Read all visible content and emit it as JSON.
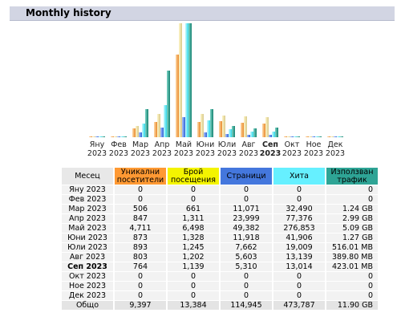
{
  "section_title": "Monthly history",
  "colors": {
    "visitors": "#ff9933",
    "visits": "#f4f400",
    "pages": "#4477dd",
    "hits": "#66f0ff",
    "bandwidth": "#2ea495"
  },
  "chart_data": {
    "type": "bar",
    "categories": [
      {
        "month": "Яну",
        "year": "2023",
        "bold": false
      },
      {
        "month": "Фев",
        "year": "2023",
        "bold": false
      },
      {
        "month": "Мар",
        "year": "2023",
        "bold": false
      },
      {
        "month": "Апр",
        "year": "2023",
        "bold": false
      },
      {
        "month": "Май",
        "year": "2023",
        "bold": false
      },
      {
        "month": "Юни",
        "year": "2023",
        "bold": false
      },
      {
        "month": "Юли",
        "year": "2023",
        "bold": false
      },
      {
        "month": "Авг",
        "year": "2023",
        "bold": false
      },
      {
        "month": "Сеп",
        "year": "2023",
        "bold": true
      },
      {
        "month": "Окт",
        "year": "2023",
        "bold": false
      },
      {
        "month": "Ное",
        "year": "2023",
        "bold": false
      },
      {
        "month": "Дек",
        "year": "2023",
        "bold": false
      }
    ],
    "series": [
      {
        "key": "visitors",
        "values": [
          0,
          0,
          506,
          847,
          4711,
          873,
          893,
          803,
          764,
          0,
          0,
          0
        ]
      },
      {
        "key": "visits",
        "values": [
          0,
          0,
          661,
          1311,
          6498,
          1328,
          1245,
          1202,
          1139,
          0,
          0,
          0
        ]
      },
      {
        "key": "pages",
        "values": [
          0,
          0,
          11071,
          23999,
          49382,
          11918,
          7662,
          5603,
          5310,
          0,
          0,
          0
        ]
      },
      {
        "key": "hits",
        "values": [
          0,
          0,
          32490,
          77376,
          276853,
          41906,
          19009,
          13139,
          13014,
          0,
          0,
          0
        ]
      },
      {
        "key": "bandwidth",
        "values": [
          0,
          0,
          1.24,
          2.99,
          5.09,
          1.27,
          0.504,
          0.381,
          0.413,
          0,
          0,
          0
        ]
      }
    ]
  },
  "table": {
    "headers": {
      "month": "Месец",
      "visitors": "Уникални посетители",
      "visits": "Брой посещения",
      "pages": "Страници",
      "hits": "Хита",
      "bandwidth": "Използван трафик"
    },
    "rows": [
      {
        "month": "Яну 2023",
        "visitors": "0",
        "visits": "0",
        "pages": "0",
        "hits": "0",
        "bandwidth": "0",
        "current": false
      },
      {
        "month": "Фев 2023",
        "visitors": "0",
        "visits": "0",
        "pages": "0",
        "hits": "0",
        "bandwidth": "0",
        "current": false
      },
      {
        "month": "Мар 2023",
        "visitors": "506",
        "visits": "661",
        "pages": "11,071",
        "hits": "32,490",
        "bandwidth": "1.24 GB",
        "current": false
      },
      {
        "month": "Апр 2023",
        "visitors": "847",
        "visits": "1,311",
        "pages": "23,999",
        "hits": "77,376",
        "bandwidth": "2.99 GB",
        "current": false
      },
      {
        "month": "Май 2023",
        "visitors": "4,711",
        "visits": "6,498",
        "pages": "49,382",
        "hits": "276,853",
        "bandwidth": "5.09 GB",
        "current": false
      },
      {
        "month": "Юни 2023",
        "visitors": "873",
        "visits": "1,328",
        "pages": "11,918",
        "hits": "41,906",
        "bandwidth": "1.27 GB",
        "current": false
      },
      {
        "month": "Юли 2023",
        "visitors": "893",
        "visits": "1,245",
        "pages": "7,662",
        "hits": "19,009",
        "bandwidth": "516.01 MB",
        "current": false
      },
      {
        "month": "Авг 2023",
        "visitors": "803",
        "visits": "1,202",
        "pages": "5,603",
        "hits": "13,139",
        "bandwidth": "389.80 MB",
        "current": false
      },
      {
        "month": "Сеп 2023",
        "visitors": "764",
        "visits": "1,139",
        "pages": "5,310",
        "hits": "13,014",
        "bandwidth": "423.01 MB",
        "current": true
      },
      {
        "month": "Окт 2023",
        "visitors": "0",
        "visits": "0",
        "pages": "0",
        "hits": "0",
        "bandwidth": "0",
        "current": false
      },
      {
        "month": "Ное 2023",
        "visitors": "0",
        "visits": "0",
        "pages": "0",
        "hits": "0",
        "bandwidth": "0",
        "current": false
      },
      {
        "month": "Дек 2023",
        "visitors": "0",
        "visits": "0",
        "pages": "0",
        "hits": "0",
        "bandwidth": "0",
        "current": false
      }
    ],
    "total": {
      "month": "Общо",
      "visitors": "9,397",
      "visits": "13,384",
      "pages": "114,945",
      "hits": "473,787",
      "bandwidth": "11.90 GB"
    }
  }
}
